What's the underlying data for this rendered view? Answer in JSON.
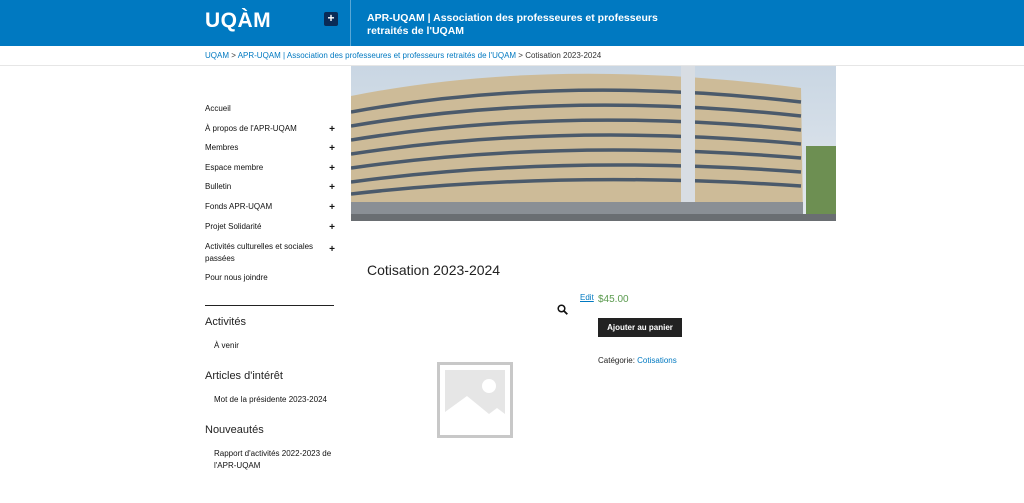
{
  "header": {
    "logo": "UQÀM",
    "menu_toggle": "+",
    "site_title": "APR-UQAM | Association des professeures et professeurs retraités de l'UQAM"
  },
  "breadcrumb": {
    "home": "UQAM",
    "sep1": " > ",
    "parent": "APR-UQAM | Association des professeures et professeurs retraités de l'UQAM",
    "sep2": " > ",
    "current": "Cotisation 2023-2024"
  },
  "sidebar": {
    "nav": [
      {
        "label": "Accueil",
        "expand": ""
      },
      {
        "label": "À propos de l'APR-UQAM",
        "expand": "+"
      },
      {
        "label": "Membres",
        "expand": "+"
      },
      {
        "label": "Espace membre",
        "expand": "+"
      },
      {
        "label": "Bulletin",
        "expand": "+"
      },
      {
        "label": "Fonds APR-UQAM",
        "expand": "+"
      },
      {
        "label": "Projet Solidarité",
        "expand": "+"
      },
      {
        "label": "Activités culturelles et sociales passées",
        "expand": "+"
      },
      {
        "label": "Pour nous joindre",
        "expand": ""
      }
    ],
    "widgets": [
      {
        "title": "Activités",
        "items": [
          "À venir"
        ]
      },
      {
        "title": "Articles d'intérêt",
        "items": [
          "Mot de la présidente 2023-2024"
        ]
      },
      {
        "title": "Nouveautés",
        "items": [
          "Rapport d'activités 2022-2023 de l'APR-UQAM"
        ]
      }
    ]
  },
  "product": {
    "title": "Cotisation 2023-2024",
    "edit": "Edit",
    "price": "$45.00",
    "add_to_cart": "Ajouter au panier",
    "category_label": "Catégorie: ",
    "category_value": "Cotisations",
    "zoom_icon": "magnifier-icon"
  },
  "colors": {
    "header_blue": "#0079c1",
    "link_blue": "#0079c1",
    "price_green": "#5a9a4e",
    "button_dark": "#222222"
  }
}
